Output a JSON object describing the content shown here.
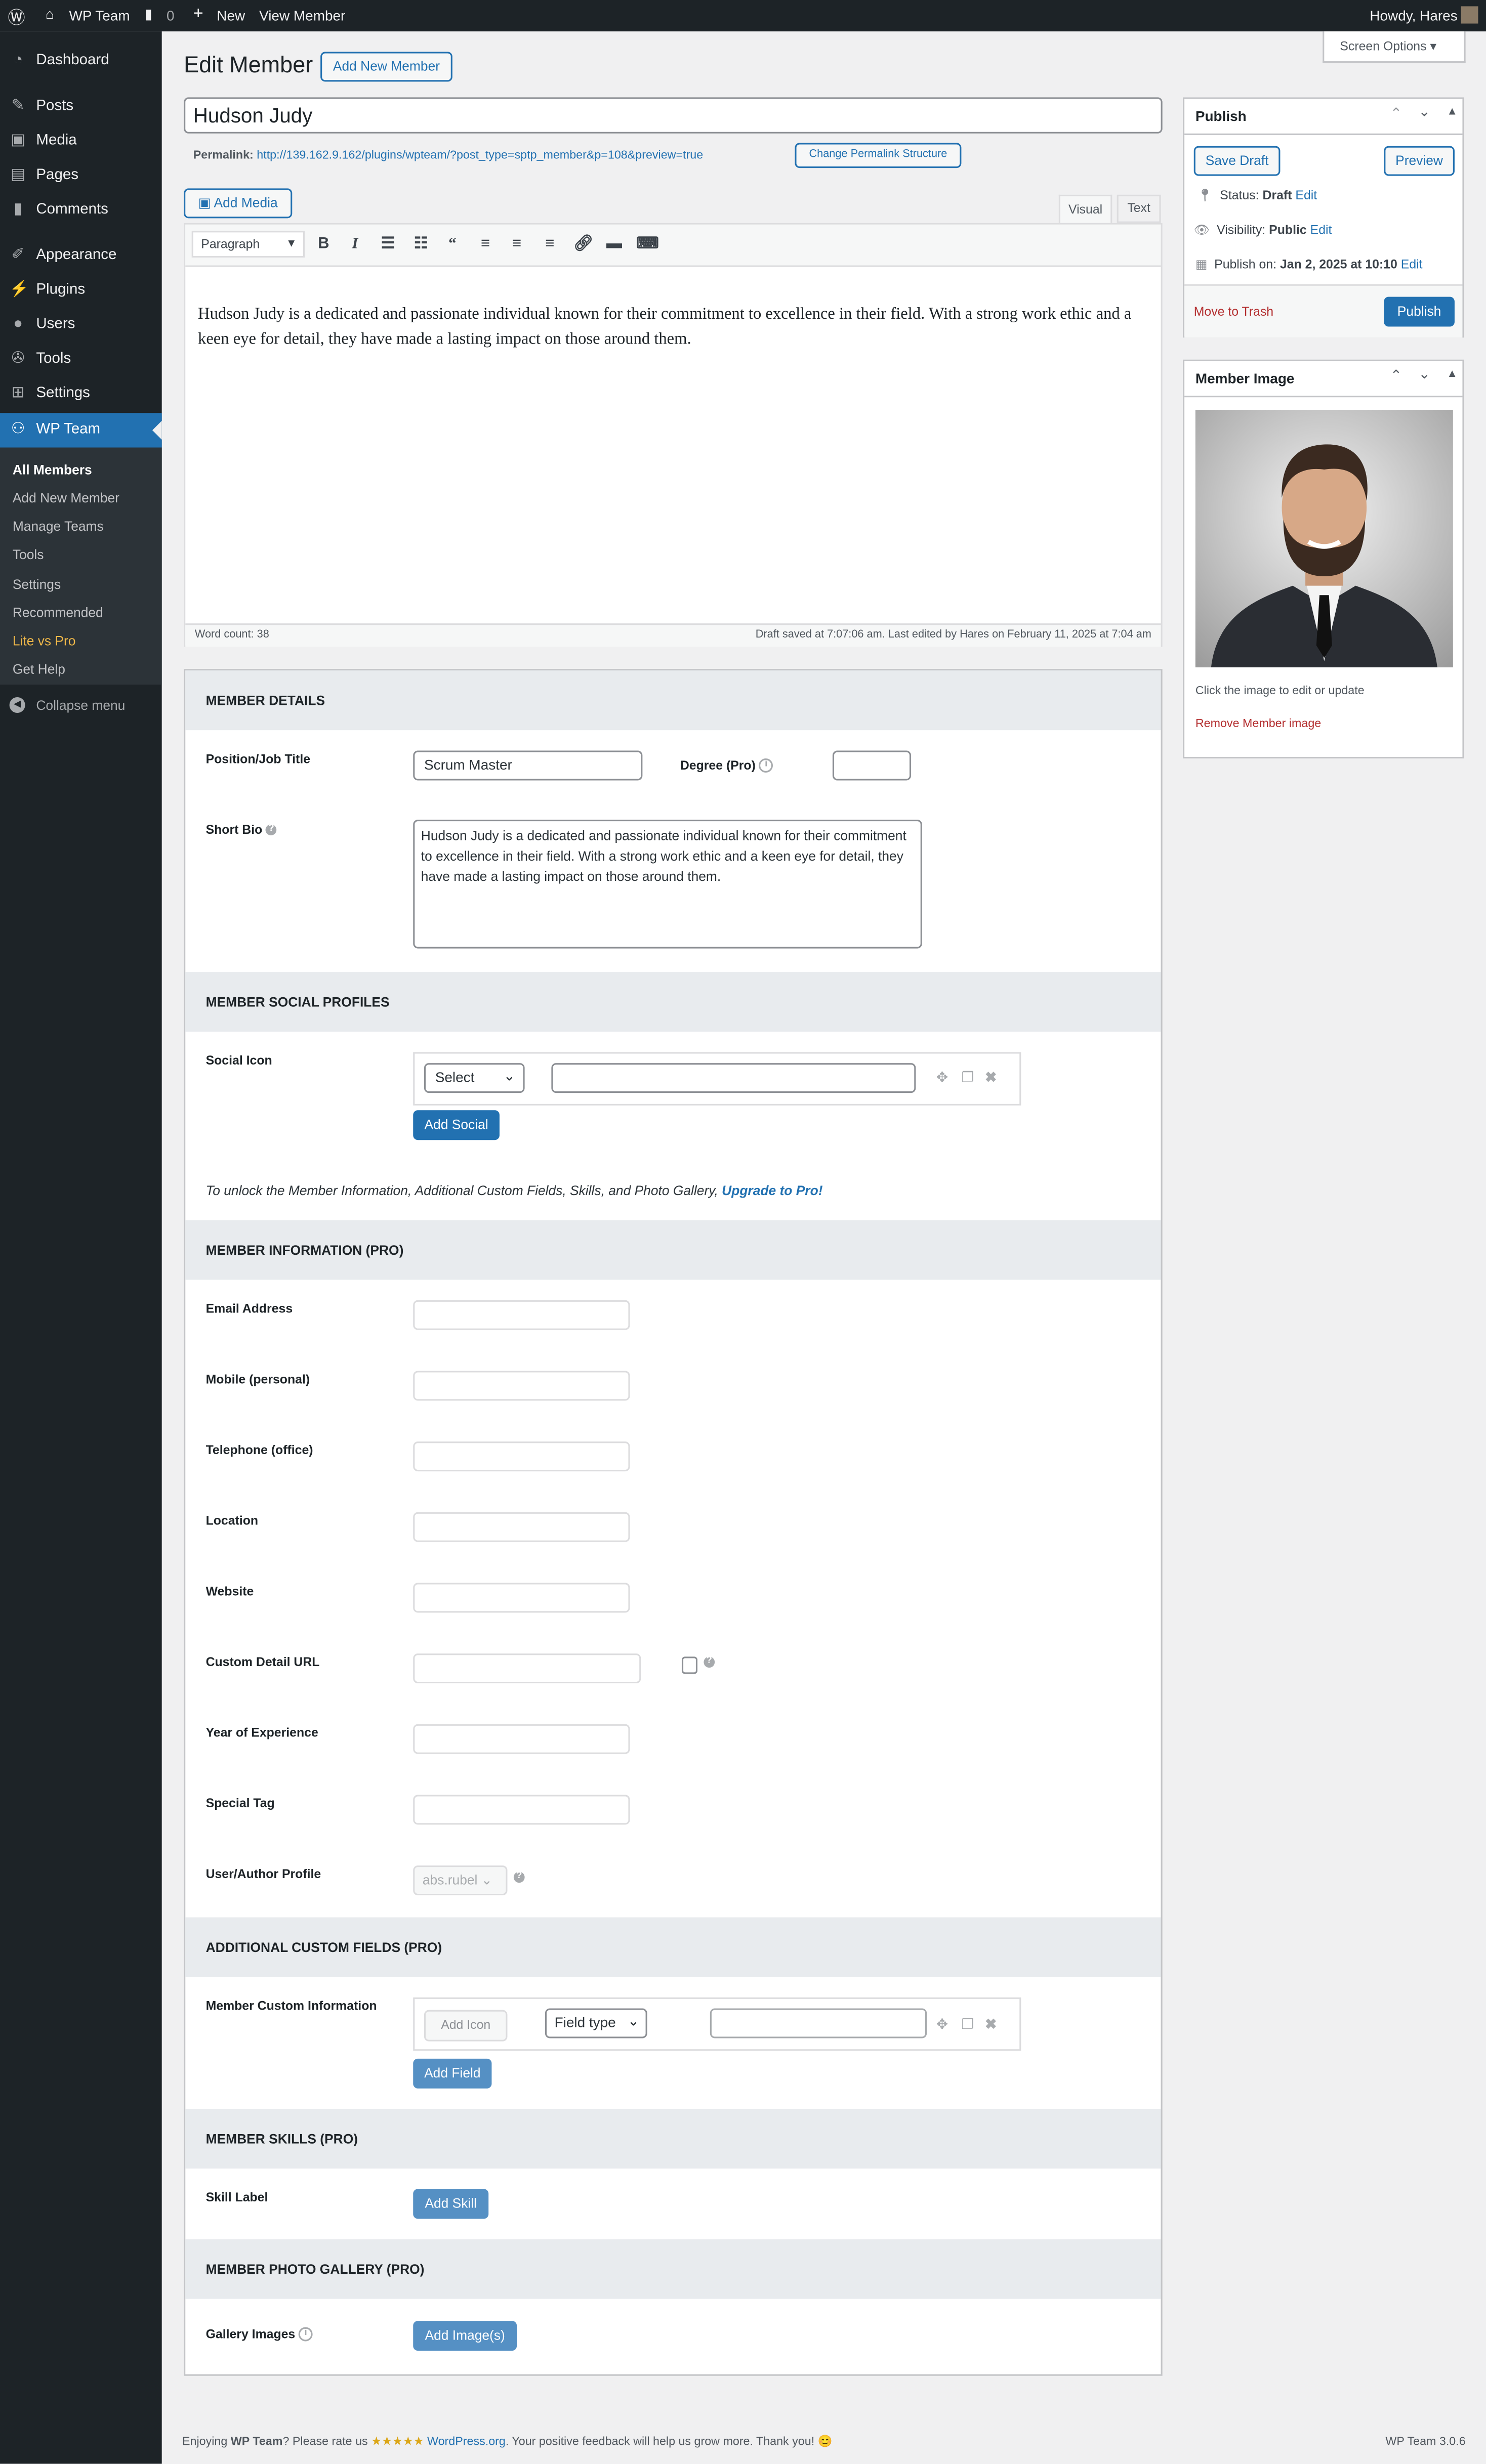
{
  "admin_bar": {
    "site_name": "WP Team",
    "comments_count": "0",
    "new_label": "New",
    "view_label": "View Member",
    "greeting": "Howdy, Hares"
  },
  "sidebar": {
    "items": [
      {
        "label": "Dashboard",
        "icon": "dashboard-icon"
      },
      {
        "label": "Posts",
        "icon": "pin-icon"
      },
      {
        "label": "Media",
        "icon": "media-icon"
      },
      {
        "label": "Pages",
        "icon": "pages-icon"
      },
      {
        "label": "Comments",
        "icon": "comment-icon"
      },
      {
        "label": "Appearance",
        "icon": "brush-icon"
      },
      {
        "label": "Plugins",
        "icon": "plugin-icon"
      },
      {
        "label": "Users",
        "icon": "users-icon"
      },
      {
        "label": "Tools",
        "icon": "wrench-icon"
      },
      {
        "label": "Settings",
        "icon": "settings-icon"
      },
      {
        "label": "WP Team",
        "icon": "team-icon"
      }
    ],
    "submenu": [
      "All Members",
      "Add New Member",
      "Manage Teams",
      "Tools",
      "Settings",
      "Recommended",
      "Lite vs Pro",
      "Get Help"
    ],
    "collapse": "Collapse menu"
  },
  "header": {
    "title": "Edit Member",
    "add_new": "Add New Member",
    "screen_options": "Screen Options"
  },
  "post": {
    "title": "Hudson Judy",
    "permalink_label": "Permalink:",
    "permalink_url": "http://139.162.9.162/plugins/wpteam/?post_type=sptp_member&p=108&preview=true",
    "change_permalink": "Change Permalink Structure"
  },
  "editor": {
    "add_media": "Add Media",
    "tab_visual": "Visual",
    "tab_text": "Text",
    "format": "Paragraph",
    "content": "Hudson Judy is a dedicated and passionate individual known for their commitment to excellence in their field. With a strong work ethic and a keen eye for detail, they have made a lasting impact on those around them.",
    "word_count": "Word count: 38",
    "draft_status": "Draft saved at 7:07:06 am. Last edited by Hares on February 11, 2025 at 7:04 am"
  },
  "publish": {
    "title": "Publish",
    "save_draft": "Save Draft",
    "preview": "Preview",
    "status_label": "Status:",
    "status_value": "Draft",
    "visibility_label": "Visibility:",
    "visibility_value": "Public",
    "publish_on_label": "Publish on:",
    "publish_on_value": "Jan 2, 2025 at 10:10",
    "edit": "Edit",
    "trash": "Move to Trash",
    "publish_button": "Publish"
  },
  "member_image": {
    "title": "Member Image",
    "caption": "Click the image to edit or update",
    "remove": "Remove Member image"
  },
  "details": {
    "header": "MEMBER DETAILS",
    "position_label": "Position/Job Title",
    "position_value": "Scrum Master",
    "degree_label": "Degree (Pro)",
    "bio_label": "Short Bio",
    "bio_value": "Hudson Judy is a dedicated and passionate individual known for their commitment to excellence in their field. With a strong work ethic and a keen eye for detail, they have made a lasting impact on those around them."
  },
  "social": {
    "header": "MEMBER SOCIAL PROFILES",
    "label": "Social Icon",
    "select": "Select",
    "add_button": "Add Social",
    "unlock_text": "To unlock the Member Information, Additional Custom Fields, Skills, and Photo Gallery, ",
    "upgrade_link": "Upgrade to Pro!"
  },
  "information": {
    "header": "MEMBER INFORMATION (PRO)",
    "fields": [
      "Email Address",
      "Mobile (personal)",
      "Telephone (office)",
      "Location",
      "Website",
      "Custom Detail URL",
      "Year of Experience",
      "Special Tag",
      "User/Author Profile"
    ],
    "author_value": "abs.rubel"
  },
  "custom_fields": {
    "header": "ADDITIONAL CUSTOM FIELDS (PRO)",
    "label": "Member Custom Information",
    "add_icon": "Add Icon",
    "field_type": "Field type",
    "add_button": "Add Field"
  },
  "skills": {
    "header": "MEMBER SKILLS (PRO)",
    "label": "Skill Label",
    "add_button": "Add Skill"
  },
  "gallery": {
    "header": "MEMBER PHOTO GALLERY (PRO)",
    "label": "Gallery Images",
    "add_button": "Add Image(s)"
  },
  "footer": {
    "text_before": "Enjoying ",
    "brand": "WP Team",
    "text_mid": "? Please rate us ",
    "stars": "★★★★★",
    "link": "WordPress.org",
    "text_after": ". Your positive feedback will help us grow more. Thank you! 😊",
    "version": "WP Team 3.0.6"
  },
  "colors": {
    "accent": "#2271b1",
    "sidebar": "#1d2327",
    "submenu": "#2c3338",
    "highlight": "#f0b849",
    "danger": "#b32d2e"
  }
}
